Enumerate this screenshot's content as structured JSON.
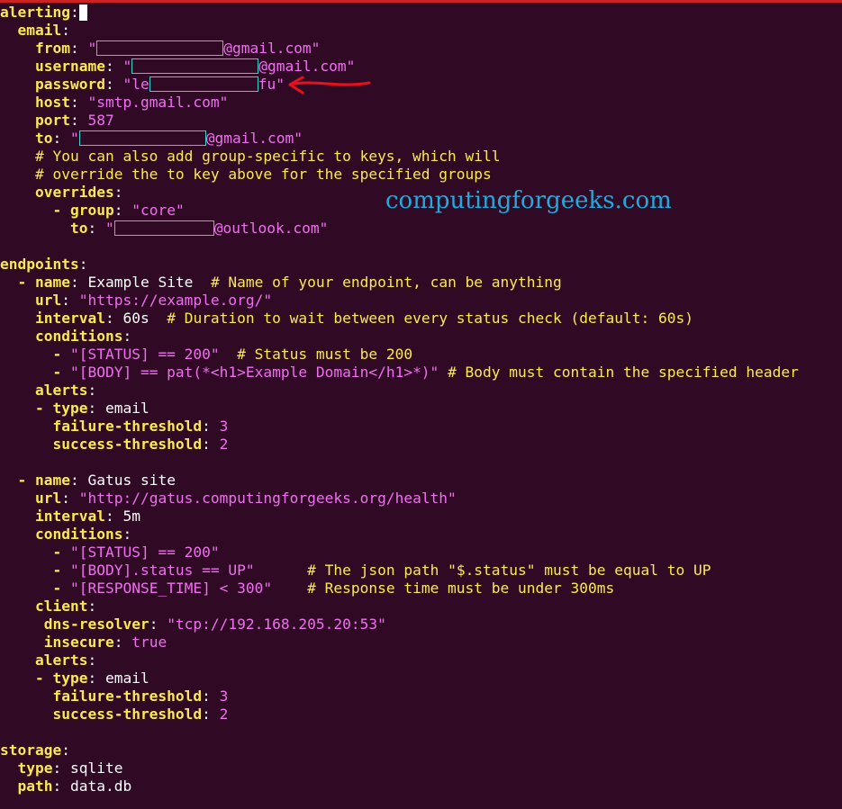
{
  "watermark": "computingforgeeks.com",
  "colors": {
    "background": "#300a24",
    "key": "#fce94f",
    "string": "#ef6ff0",
    "comment": "#fce94f",
    "redaction": "#3ad3c6",
    "arrow": "#e8101e",
    "topbar": "#cc2222"
  },
  "code": {
    "alerting": "alerting",
    "email": "email",
    "from": "from",
    "from_suffix": "@gmail.com\"",
    "username": "username",
    "username_suffix": "@gmail.com\"",
    "password": "password",
    "password_prefix": "\"le",
    "password_suffix": "fu\"",
    "host": "host",
    "host_val": "\"smtp.gmail.com\"",
    "port": "port",
    "port_val": "587",
    "to": "to",
    "to_suffix": "@gmail.com\"",
    "comment1": "# You can also add group-specific to keys, which will",
    "comment2": "# override the to key above for the specified groups",
    "overrides": "overrides",
    "group": "group",
    "group_val": "\"core\"",
    "to2_suffix": "@outlook.com\"",
    "endpoints": "endpoints",
    "name": "name",
    "ep1_name": "Example Site",
    "ep1_name_comment": "# Name of your endpoint, can be anything",
    "url": "url",
    "ep1_url": "\"https://example.org/\"",
    "interval": "interval",
    "ep1_interval": "60s",
    "ep1_interval_comment": "# Duration to wait between every status check (default: 60s)",
    "conditions": "conditions",
    "ep1_cond1": "\"[STATUS] == 200\"",
    "ep1_cond1_comment": "# Status must be 200",
    "ep1_cond2": "\"[BODY] == pat(*<h1>Example Domain</h1>*)\"",
    "ep1_cond2_comment": "# Body must contain the specified header",
    "alerts": "alerts",
    "type": "type",
    "alert_type": "email",
    "failure_threshold": "failure-threshold",
    "failure_val": "3",
    "success_threshold": "success-threshold",
    "success_val": "2",
    "ep2_name": "Gatus site",
    "ep2_url": "\"http://gatus.computingforgeeks.org/health\"",
    "ep2_interval": "5m",
    "ep2_cond1": "\"[STATUS] == 200\"",
    "ep2_cond2": "\"[BODY].status == UP\"",
    "ep2_cond2_comment": "# The json path \"$.status\" must be equal to UP",
    "ep2_cond3": "\"[RESPONSE_TIME] < 300\"",
    "ep2_cond3_comment": "# Response time must be under 300ms",
    "client": "client",
    "dns_resolver": "dns-resolver",
    "dns_val": "\"tcp://192.168.205.20:53\"",
    "insecure": "insecure",
    "insecure_val": "true",
    "storage": "storage",
    "storage_type_val": "sqlite",
    "path": "path",
    "path_val": "data.db"
  }
}
